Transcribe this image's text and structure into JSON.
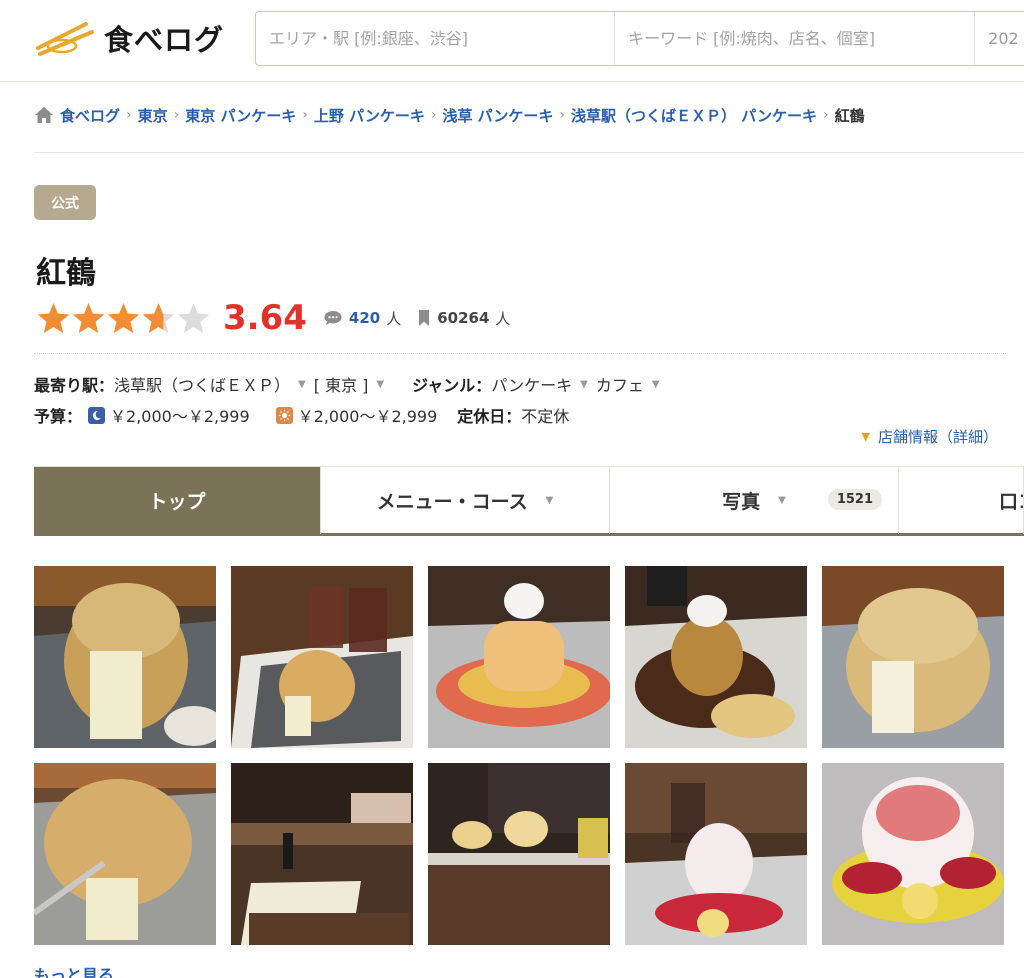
{
  "header": {
    "logo_text": "食べログ",
    "area_placeholder": "エリア・駅 [例:銀座、渋谷]",
    "keyword_placeholder": "キーワード [例:焼肉、店名、個室]",
    "date_text": "202"
  },
  "breadcrumb": {
    "items": [
      "食べログ",
      "東京",
      "東京 パンケーキ",
      "上野 パンケーキ",
      "浅草 パンケーキ",
      "浅草駅（つくばＥＸＰ） パンケーキ",
      "紅鶴"
    ]
  },
  "badge": "公式",
  "restaurant": {
    "name": "紅鶴",
    "rating": 3.64,
    "score_text": "3.64",
    "reviews_count": "420",
    "reviews_unit": "人",
    "bookmarks_count": "60264",
    "bookmarks_unit": "人"
  },
  "info": {
    "station_label": "最寄り駅：",
    "station_value": "浅草駅（つくばＥＸＰ）",
    "area_value": "[ 東京 ]",
    "genre_label": "ジャンル：",
    "genre_values": [
      "パンケーキ",
      "カフェ"
    ],
    "budget_label": "予算：",
    "dinner_budget": "￥2,000～￥2,999",
    "lunch_budget": "￥2,000～￥2,999",
    "holiday_label": "定休日：",
    "holiday_value": "不定休",
    "detail_link": "店舗情報（詳細）"
  },
  "tabs": [
    {
      "label": "トップ"
    },
    {
      "label": "メニュー・コース"
    },
    {
      "label": "写真",
      "count": "1521"
    },
    {
      "label": "口コ"
    }
  ],
  "more_link": "もっと見る",
  "colors": {
    "accent": "#7b7358",
    "link": "#2a5fa8",
    "score": "#e0322a",
    "star": "#f28d35",
    "badge": "#b5aa8f"
  }
}
